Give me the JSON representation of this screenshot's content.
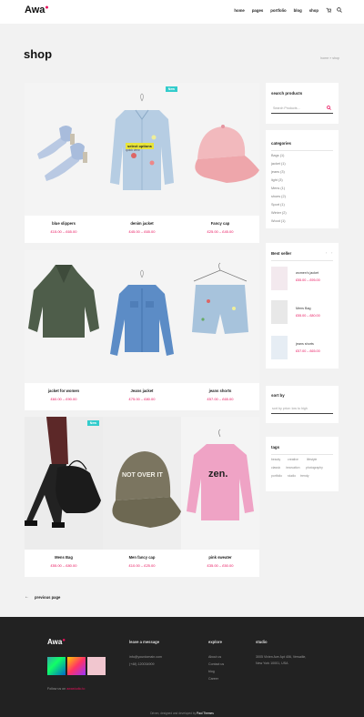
{
  "header": {
    "logo": "Awa",
    "nav": [
      "home",
      "pages",
      "portfolio",
      "blog",
      "shop"
    ]
  },
  "page": {
    "title": "shop",
    "breadcrumb": "home  »  shop"
  },
  "products": [
    {
      "name": "blue slippers",
      "price": "£15.00 – £65.00",
      "badge": ""
    },
    {
      "name": "denim jacket",
      "price": "£45.00 – £65.00",
      "badge": "New",
      "overlay": "select options",
      "overlay2": "quick view"
    },
    {
      "name": "Fancy cap",
      "price": "£25.00 – £45.00",
      "badge": ""
    },
    {
      "name": "jacket for women",
      "price": "£60.00 – £90.00",
      "badge": ""
    },
    {
      "name": "Jeans jacket",
      "price": "£75.00 – £80.00",
      "badge": ""
    },
    {
      "name": "jeans shorts",
      "price": "£57.00 – £65.00",
      "badge": ""
    },
    {
      "name": "Mens Bag",
      "price": "£55.00 – £80.00",
      "badge": "New"
    },
    {
      "name": "Men fancy cap",
      "price": "£10.00 – £25.00",
      "badge": ""
    },
    {
      "name": "pink sweater",
      "price": "£35.00 – £50.00",
      "badge": ""
    }
  ],
  "sidebar": {
    "search": {
      "title": "search products",
      "placeholder": "Search Products..."
    },
    "categories": {
      "title": "categories",
      "items": [
        "Bags (1)",
        "jacket (1)",
        "jeans (3)",
        "light (3)",
        "Mens (1)",
        "shoes (2)",
        "Sport (1)",
        "Winter (2)",
        "Wood (1)"
      ]
    },
    "best_seller": {
      "title": "Best seller",
      "items": [
        {
          "name": "women's jacket",
          "price": "£55.00 – £95.00"
        },
        {
          "name": "Mens Bag",
          "price": "£55.00 – £80.00"
        },
        {
          "name": "jeans shorts",
          "price": "£57.00 – £65.00"
        }
      ]
    },
    "sort": {
      "title": "sort by",
      "value": "sort by price: low to high"
    },
    "tags": {
      "title": "tags",
      "items": [
        "beauty",
        "creative",
        "lifestyle",
        "classic",
        "innovation",
        "photography",
        "portfolio",
        "studio",
        "trendy"
      ]
    }
  },
  "pagination": {
    "prev": "previous page"
  },
  "footer": {
    "logo": "Awa",
    "follow": "Follow us on",
    "follow_handle": "awastudio.to",
    "message_title": "leave a message",
    "email": "info@yourdomain.com",
    "phone": "(+48) 120034909",
    "explore_title": "explore",
    "explore_items": [
      "About us",
      "Contact us",
      "blog",
      "Career"
    ],
    "studio_title": "studio",
    "address": "3005 Vivien Ave Apt 406, Versaille,",
    "address2": "New York 10001, USA",
    "copyright": "Driven, designed and developed by",
    "copyright_brand": "Paul Themes"
  },
  "colors": {
    "accent": "#e8115c",
    "badge": "#33cccc",
    "footer": "#222222"
  }
}
